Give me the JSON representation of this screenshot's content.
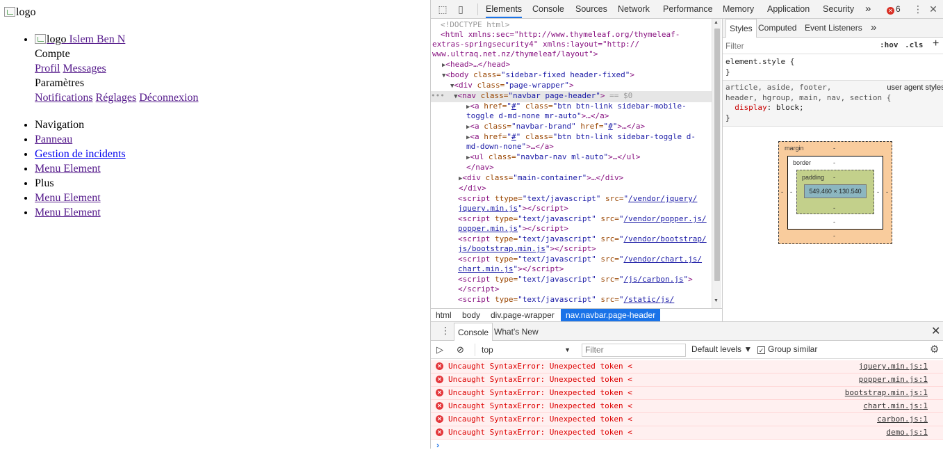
{
  "page": {
    "brand_alt": "logo",
    "user_alt": "logo",
    "user_name": " Islem Ben N",
    "account_header": "Compte",
    "account_links": [
      "Profil",
      "Messages"
    ],
    "settings_header": "Paramètres",
    "settings_links": [
      "Notifications",
      "Réglages",
      "Déconnexion"
    ],
    "nav_header": "Navigation",
    "nav_items": [
      "Panneau",
      "Gestion de incidents",
      "Menu Element"
    ],
    "more_header": "Plus",
    "more_items": [
      "Menu Element",
      "Menu Element"
    ]
  },
  "devtools": {
    "tabs": [
      "Elements",
      "Console",
      "Sources",
      "Network",
      "Performance",
      "Memory",
      "Application",
      "Security"
    ],
    "more_tabs": "»",
    "error_count": "6",
    "icons": {
      "inspect": "inspect-icon",
      "device": "device-toolbar-icon",
      "kebab": "kebab-menu-icon"
    },
    "dom": {
      "doctype": "<!DOCTYPE html>",
      "html_line1": "<html xmlns:sec=\"http://www.thymeleaf.org/thymeleaf-",
      "html_line2": "extras-springsecurity4\" xmlns:layout=\"http://",
      "html_line3": "www.ultraq.net.nz/thymeleaf/layout\">",
      "head": "<head>…</head>",
      "body_tag": "<body",
      "body_attr": " class=",
      "body_val": "\"sidebar-fixed header-fixed\"",
      "div_wrapper_val": "\"page-wrapper\"",
      "nav_val": "\"navbar page-header\"",
      "sel_marker": " == $0",
      "a1_l1_href": "#",
      "a1_l1_val": "\"btn btn-link sidebar-mobile-",
      "a1_l2": "toggle d-md-none mr-auto\"",
      "a2_val": "\"navbar-brand\"",
      "a2_href": "#",
      "a3_href": "#",
      "a3_val": "\"btn btn-link sidebar-toggle d-",
      "a3_l2": "md-down-none\"",
      "ul_val": "\"navbar-nav ml-auto\"",
      "nav_close": "</nav>",
      "main_val": "\"main-container\"",
      "div_close": "</div>",
      "scripts": [
        {
          "attr": "ttype",
          "val": "\"text/javascript\"",
          "src1": "/vendor/jquery/",
          "src2": "jquery.min.js"
        },
        {
          "attr": "type",
          "val": "\"text/javascript\"",
          "src1": "/vendor/popper.js/",
          "src2": "popper.min.js"
        },
        {
          "attr": "type",
          "val": "\"text/javascript\"",
          "src1": "/vendor/bootstrap/",
          "src2": "js/bootstrap.min.js"
        },
        {
          "attr": "type",
          "val": "\"text/javascript\"",
          "src1": "/vendor/chart.js/",
          "src2": "chart.min.js"
        }
      ],
      "script5_src": "/js/carbon.js",
      "script6_src": "/static/js/"
    },
    "breadcrumbs": [
      "html",
      "body",
      "div.page-wrapper",
      "nav.navbar.page-header"
    ],
    "styles": {
      "tabs": [
        "Styles",
        "Computed",
        "Event Listeners"
      ],
      "more": "»",
      "filter_placeholder": "Filter",
      "hov": ":hov",
      "cls": ".cls",
      "plus": "+",
      "element_style": "element.style {",
      "close_brace": "}",
      "ua_selector_l1": "article, aside, footer,",
      "ua_selector_l2": "header, hgroup, main, nav, section {",
      "ua_source": "user agent stylesheet",
      "ua_prop": "display",
      "ua_value": ": block;",
      "box": {
        "margin": "margin",
        "border": "border",
        "padding": "padding",
        "content": "549.460 × 130.540",
        "dash": "-"
      }
    },
    "drawer": {
      "tabs": [
        "Console",
        "What's New"
      ],
      "context": "top",
      "filter_placeholder": "Filter",
      "levels": "Default levels ▼",
      "group_similar": "Group similar",
      "messages": [
        {
          "text": "Uncaught SyntaxError: Unexpected token <",
          "source": "jquery.min.js:1"
        },
        {
          "text": "Uncaught SyntaxError: Unexpected token <",
          "source": "popper.min.js:1"
        },
        {
          "text": "Uncaught SyntaxError: Unexpected token <",
          "source": "bootstrap.min.js:1"
        },
        {
          "text": "Uncaught SyntaxError: Unexpected token <",
          "source": "chart.min.js:1"
        },
        {
          "text": "Uncaught SyntaxError: Unexpected token <",
          "source": "carbon.js:1"
        },
        {
          "text": "Uncaught SyntaxError: Unexpected token <",
          "source": "demo.js:1"
        }
      ],
      "prompt": "›"
    }
  }
}
